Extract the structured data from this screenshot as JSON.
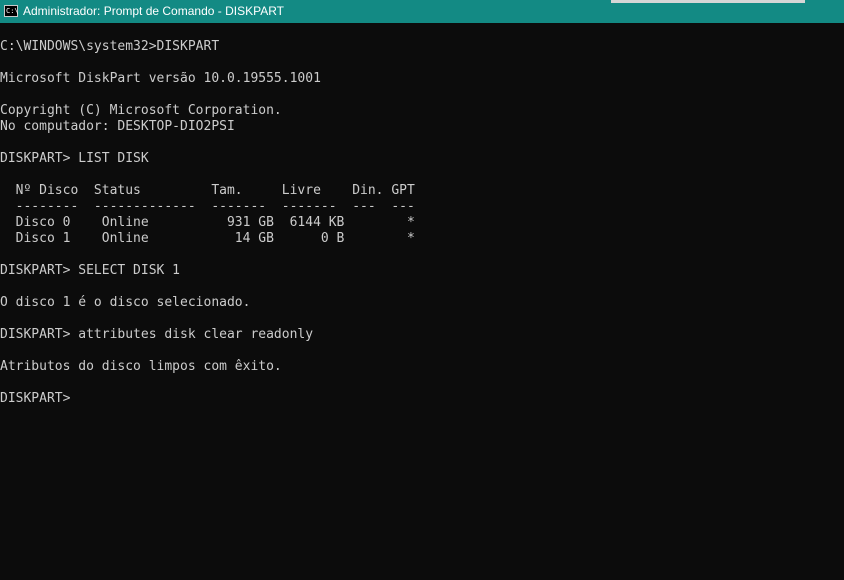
{
  "window": {
    "title": "Administrador: Prompt de Comando - DISKPART",
    "icon_text": "C:\\"
  },
  "console": {
    "lines": [
      "C:\\WINDOWS\\system32>DISKPART",
      "Microsoft DiskPart versão 10.0.19555.1001",
      "Copyright (C) Microsoft Corporation.",
      "No computador: DESKTOP-DIO2PSI",
      "DISKPART> LIST DISK",
      "  Nº Disco  Status         Tam.     Livre    Din. GPT",
      "  --------  -------------  -------  -------  ---  ---",
      "  Disco 0    Online          931 GB  6144 KB        *",
      "  Disco 1    Online           14 GB      0 B        *",
      "DISKPART> SELECT DISK 1",
      "O disco 1 é o disco selecionado.",
      "DISKPART> attributes disk clear readonly",
      "Atributos do disco limpos com êxito.",
      "DISKPART>"
    ]
  },
  "colors": {
    "titlebar": "#138a84",
    "console_bg": "#0c0c0c",
    "console_fg": "#cccccc"
  }
}
